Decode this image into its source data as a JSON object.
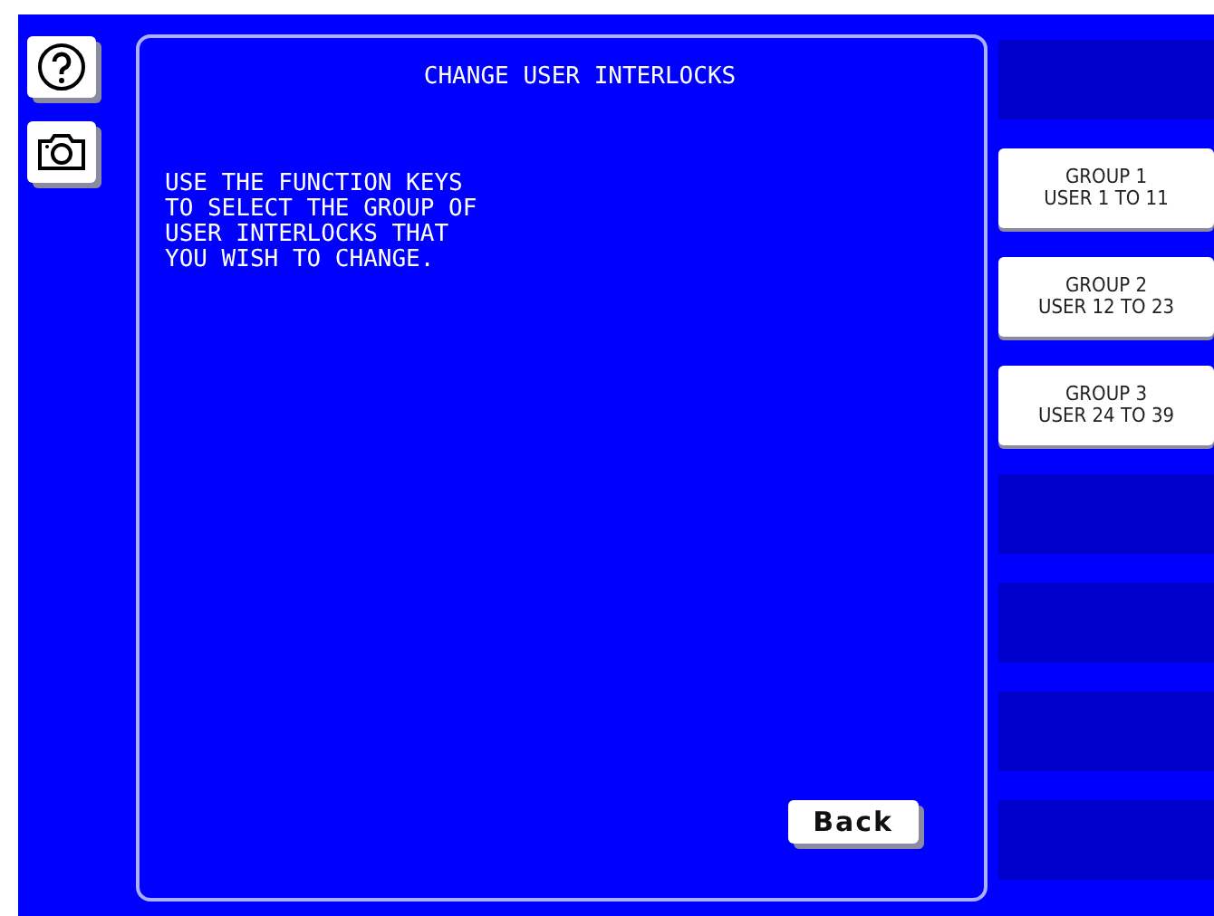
{
  "side_buttons": [
    {
      "kind": "help"
    },
    {
      "kind": "camera"
    }
  ],
  "panel": {
    "title": "CHANGE USER INTERLOCKS",
    "message": "USE THE FUNCTION KEYS\nTO SELECT THE GROUP OF\nUSER INTERLOCKS THAT\nYOU WISH TO CHANGE.",
    "back_button": "Back"
  },
  "function_keys": [
    {
      "kind": "blank"
    },
    {
      "kind": "key",
      "line_1": "GROUP 1",
      "line_2": "USER 1 TO 11"
    },
    {
      "kind": "key",
      "line_1": "GROUP 2",
      "line_2": "USER 12 TO 23"
    },
    {
      "kind": "key",
      "line_1": "GROUP 3",
      "line_2": "USER 24 TO 39"
    },
    {
      "kind": "blank"
    },
    {
      "kind": "blank"
    },
    {
      "kind": "blank"
    },
    {
      "kind": "blank"
    }
  ]
}
